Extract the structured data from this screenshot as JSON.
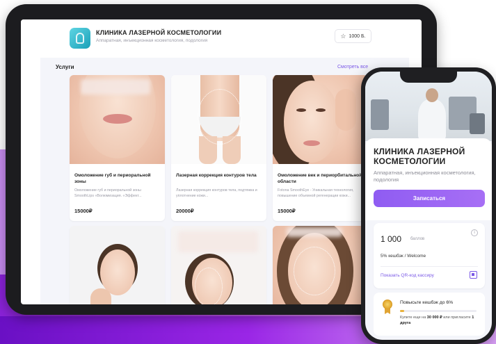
{
  "tablet": {
    "clinic_name": "КЛИНИКА ЛАЗЕРНОЙ КОСМЕТОЛОГИИ",
    "clinic_subtitle": "Аппаратная, инъекционная косметология, подология",
    "points_label": "1000 Б.",
    "section_title": "Услуги",
    "see_all": "Смотреть все",
    "services": [
      {
        "name": "Омоложение губ и периоральной зоны",
        "desc": "Омоложение губ и периоральной зоны SmoothLips «Волюмизация. «Эффект...",
        "price": "15000₽"
      },
      {
        "name": "Лазерная коррекция контуров тела",
        "desc": "Лазерная коррекция контуров тела, подтяжка и уплотнение кожи...",
        "price": "20000₽"
      },
      {
        "name": "Омоложение век и периорбитальной области",
        "desc": "Fotona SmoothEye - Уникальная технология, повышение объемной регенерации кожи...",
        "price": "15000₽"
      }
    ]
  },
  "phone": {
    "clinic_name": "КЛИНИКА ЛАЗЕРНОЙ КОСМЕТОЛОГИИ",
    "clinic_subtitle": "Аппаратная, инъекционная косметология, подология",
    "book_button": "Записаться",
    "points_value": "1 000",
    "points_unit": "баллов",
    "info_icon": "i",
    "cashback": "5% кешбэк / Welcome",
    "qr_link": "Показать QR-код кассиру",
    "level_title": "Повысьте кешбэк до 6%",
    "level_progress": 0.05,
    "level_hint_prefix": "Купите еще на",
    "level_hint_amount": "30 000 ₽",
    "level_hint_mid": "или пригласите",
    "level_hint_friend": "1 друга"
  },
  "colors": {
    "accent": "#8f5cf2",
    "link": "#7a58e6",
    "logo": "#1aa0b8",
    "medal": "#e3a92f"
  },
  "icons": [
    "star-icon",
    "info-icon",
    "qr-icon",
    "medal-icon",
    "clinic-logo-icon"
  ]
}
